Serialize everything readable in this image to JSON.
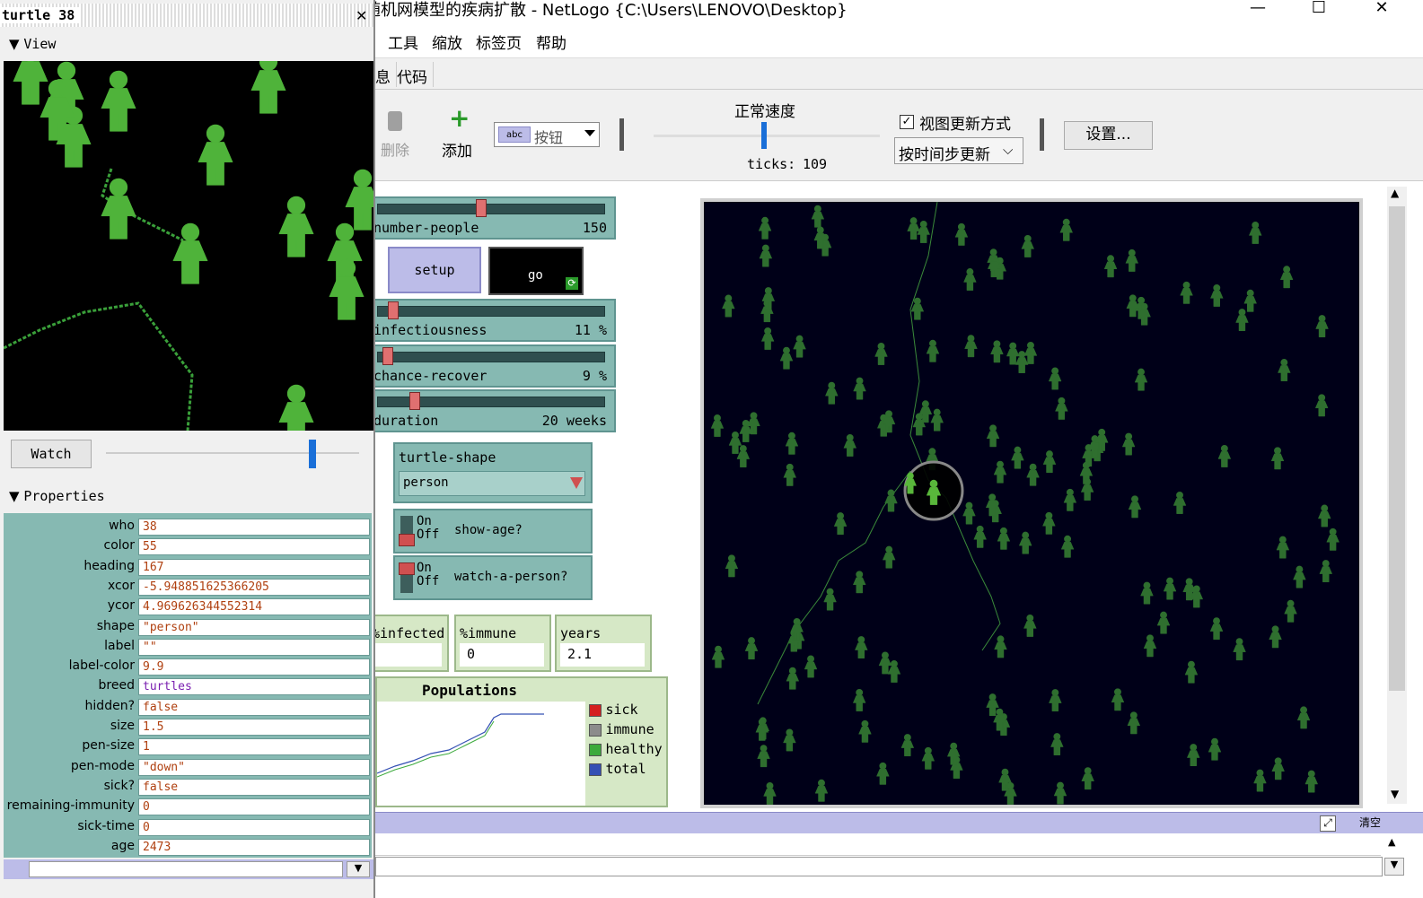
{
  "app": {
    "title": "基于随机网模型的疾病扩散 - NetLogo {C:\\Users\\LENOVO\\Desktop}",
    "window_controls": {
      "minimize": "—",
      "maximize": "☐",
      "close": "✕"
    }
  },
  "menu": {
    "items": [
      "工具",
      "缩放",
      "标签页",
      "帮助"
    ]
  },
  "tabs": {
    "partial": "息",
    "code": "代码"
  },
  "toolbar": {
    "delete_label": "删除",
    "add_label": "添加",
    "widget_type": "按钮",
    "widget_type_badge": "abc",
    "speed_label": "正常速度",
    "ticks_label": "ticks:",
    "ticks_value": "109",
    "view_updates_label": "视图更新方式",
    "view_updates_checked": true,
    "update_mode": "按时间步更新",
    "settings_label": "设置..."
  },
  "interface": {
    "sliders": [
      {
        "name": "number-people",
        "label": "number-people",
        "value": "150",
        "unit": "",
        "fraction": 0.45
      },
      {
        "name": "infectiousness",
        "label": "infectiousness",
        "value": "11",
        "unit": "%",
        "fraction": 0.09
      },
      {
        "name": "chance-recover",
        "label": "chance-recover",
        "value": "9",
        "unit": "%",
        "fraction": 0.06
      },
      {
        "name": "duration",
        "label": "duration",
        "value": "20",
        "unit": "weeks",
        "fraction": 0.18
      }
    ],
    "setup_label": "setup",
    "go_label": "go",
    "chooser": {
      "label": "turtle-shape",
      "value": "person"
    },
    "switches": [
      {
        "name": "show-age",
        "label": "show-age?",
        "on": "On",
        "off": "Off"
      },
      {
        "name": "watch-a-person",
        "label": "watch-a-person?",
        "on": "On",
        "off": "Off"
      }
    ],
    "monitors": [
      {
        "label": "%infected",
        "value": ""
      },
      {
        "label": "%immune",
        "value": "0"
      },
      {
        "label": "years",
        "value": "2.1"
      }
    ],
    "plot": {
      "title": "Populations",
      "legend": [
        {
          "label": "sick",
          "color": "#d42020"
        },
        {
          "label": "immune",
          "color": "#8c8c8c"
        },
        {
          "label": "healthy",
          "color": "#3caa3c"
        },
        {
          "label": "total",
          "color": "#3450b4"
        }
      ]
    },
    "world_colors": {
      "background": "#000018",
      "turtle": "#2f6f2f",
      "watched": "#59b73b"
    }
  },
  "command_center": {
    "clear_label": "清空"
  },
  "inspector": {
    "title": "turtle 38",
    "view_section": "View",
    "watch_label": "Watch",
    "properties_section": "Properties",
    "properties": [
      {
        "key": "who",
        "value": "38"
      },
      {
        "key": "color",
        "value": "55"
      },
      {
        "key": "heading",
        "value": "167"
      },
      {
        "key": "xcor",
        "value": "-5.948851625366205"
      },
      {
        "key": "ycor",
        "value": "4.969626344552314"
      },
      {
        "key": "shape",
        "value": "\"person\""
      },
      {
        "key": "label",
        "value": "\"\""
      },
      {
        "key": "label-color",
        "value": "9.9"
      },
      {
        "key": "breed",
        "value": "turtles"
      },
      {
        "key": "hidden?",
        "value": "false"
      },
      {
        "key": "size",
        "value": "1.5"
      },
      {
        "key": "pen-size",
        "value": "1"
      },
      {
        "key": "pen-mode",
        "value": "\"down\""
      },
      {
        "key": "sick?",
        "value": "false"
      },
      {
        "key": "remaining-immunity",
        "value": "0"
      },
      {
        "key": "sick-time",
        "value": "0"
      },
      {
        "key": "age",
        "value": "2473"
      }
    ]
  }
}
